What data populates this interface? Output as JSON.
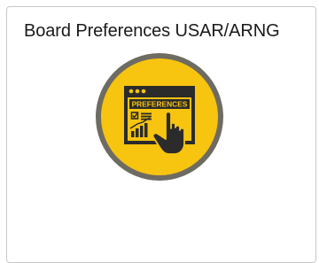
{
  "tile": {
    "title": "Board Preferences USAR/ARNG",
    "icon": "preferences-hand-pointer-icon",
    "icon_text": "PREFERENCES"
  },
  "colors": {
    "icon_ring": "#6e6b62",
    "icon_fill": "#f7c40f",
    "icon_line": "#2b2b2b",
    "tile_border": "#c8c8c8"
  }
}
